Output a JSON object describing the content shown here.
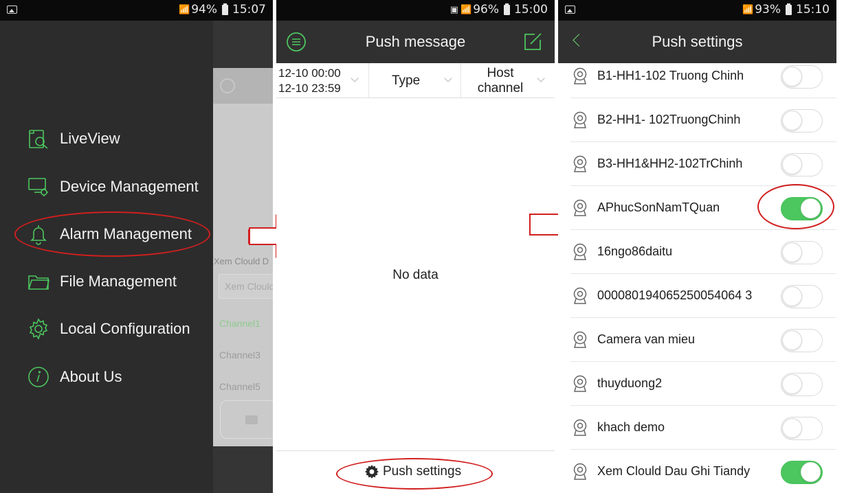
{
  "panel1": {
    "status": {
      "battery": "94%",
      "time": "15:07"
    },
    "menu": [
      {
        "label": "LiveView",
        "icon": "liveview-search-icon"
      },
      {
        "label": "Device Management",
        "icon": "device-management-icon"
      },
      {
        "label": "Alarm Management",
        "icon": "bell-icon"
      },
      {
        "label": "File Management",
        "icon": "folder-icon"
      },
      {
        "label": "Local Configuration",
        "icon": "gear-icon"
      },
      {
        "label": "About Us",
        "icon": "info-icon"
      }
    ],
    "background_view": {
      "caption": "Xem Clould D",
      "field": "Xem Clould",
      "channels": [
        "Channel1",
        "Channel3",
        "Channel5"
      ]
    }
  },
  "panel2": {
    "status": {
      "battery": "96%",
      "time": "15:00"
    },
    "title": "Push message",
    "filters": {
      "date_start": "12-10 00:00",
      "date_end": "12-10 23:59",
      "type": "Type",
      "host_channel_line1": "Host",
      "host_channel_line2": "channel"
    },
    "empty_text": "No data",
    "push_settings_label": "Push settings"
  },
  "panel3": {
    "status": {
      "battery": "93%",
      "time": "15:10"
    },
    "title": "Push settings",
    "devices": [
      {
        "name": "B1-HH1-102 Truong Chinh",
        "enabled": false
      },
      {
        "name": "B2-HH1- 102TruongChinh",
        "enabled": false
      },
      {
        "name": "B3-HH1&HH2-102TrChinh",
        "enabled": false
      },
      {
        "name": "APhucSonNamTQuan",
        "enabled": true
      },
      {
        "name": "16ngo86daitu",
        "enabled": false
      },
      {
        "name": "000080194065250054064 3",
        "enabled": false
      },
      {
        "name": "Camera van mieu",
        "enabled": false
      },
      {
        "name": "thuyduong2",
        "enabled": false
      },
      {
        "name": "khach demo",
        "enabled": false
      },
      {
        "name": "Xem Clould Dau Ghi Tiandy",
        "enabled": true
      }
    ]
  },
  "colors": {
    "accent_green": "#4cc65e",
    "annotation_red": "#d11f1f",
    "header_dark": "#303030",
    "drawer_dark": "#2c2c2c"
  }
}
